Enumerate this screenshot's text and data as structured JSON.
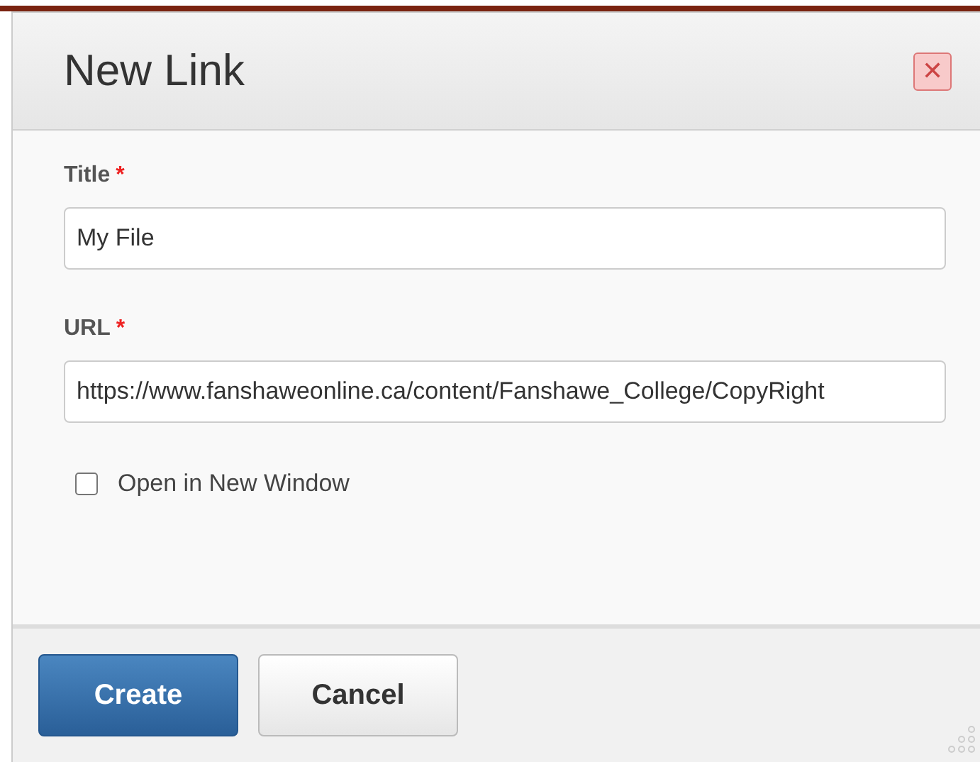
{
  "dialog": {
    "title": "New Link",
    "close_symbol": "✕"
  },
  "fields": [
    {
      "label": "Title",
      "required": true,
      "required_mark": "*",
      "value": "My File"
    },
    {
      "label": "URL",
      "required": true,
      "required_mark": "*",
      "value": "https://www.fanshaweonline.ca/content/Fanshawe_College/CopyRight"
    }
  ],
  "checkbox": {
    "label": "Open in New Window",
    "checked": false
  },
  "buttons": [
    {
      "label": "Create",
      "kind": "primary"
    },
    {
      "label": "Cancel",
      "kind": "secondary"
    }
  ]
}
